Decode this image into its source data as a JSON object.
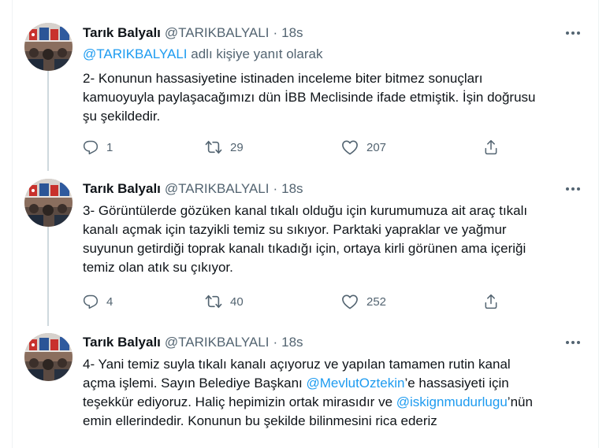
{
  "tweets": [
    {
      "author": {
        "name": "Tarık Balyalı",
        "handle": "@TARIKBALYALI"
      },
      "separator": "·",
      "time": "18s",
      "reply_to": {
        "mention": "@TARIKBALYALI",
        "suffix": " adlı kişiye yanıt olarak"
      },
      "text_lines": [
        "2- Konunun hassasiyetine istinaden inceleme biter bitmez sonuçları",
        "kamuoyuyla paylaşacağımızı dün İBB Meclisinde ifade etmiştik. İşin doğrusu",
        "şu şekildedir."
      ],
      "stats": {
        "replies": "1",
        "retweets": "29",
        "likes": "207"
      }
    },
    {
      "author": {
        "name": "Tarık Balyalı",
        "handle": "@TARIKBALYALI"
      },
      "separator": "·",
      "time": "18s",
      "text_lines": [
        "3- Görüntülerde gözüken kanal tıkalı olduğu için kurumumuza ait araç tıkalı",
        "kanalı açmak için tazyikli temiz su sıkıyor. Parktaki yapraklar ve yağmur",
        "suyunun getirdiği toprak kanalı tıkadığı için, ortaya kirli görünen ama içeriği",
        "temiz olan atık su çıkıyor."
      ],
      "stats": {
        "replies": "4",
        "retweets": "40",
        "likes": "252"
      }
    },
    {
      "author": {
        "name": "Tarık Balyalı",
        "handle": "@TARIKBALYALI"
      },
      "separator": "·",
      "time": "18s",
      "text": {
        "line1": "4- Yani temiz suyla tıkalı kanalı açıyoruz ve yapılan tamamen rutin kanal",
        "line2_before": "açma işlemi. Sayın Belediye Başkanı ",
        "line2_mention": "@MevlutOztekin",
        "line2_after": "’e hassasiyeti için",
        "line3_before": "teşekkür ediyoruz. Haliç hepimizin ortak mirasıdır ve ",
        "line3_mention": "@iskignmudurlugu",
        "line3_after": "’nün",
        "line4": "emin ellerindedir. Konunun bu şekilde bilinmesini rica ederiz"
      }
    }
  ],
  "icons": {
    "more": "more-horizontal-icon",
    "reply": "reply-icon",
    "retweet": "retweet-icon",
    "like": "heart-icon",
    "share": "share-icon"
  },
  "colors": {
    "text": "#0f1419",
    "secondary": "#536471",
    "link": "#1d9bf0",
    "divider": "#eff3f4",
    "thread_line": "#cfd9de"
  }
}
